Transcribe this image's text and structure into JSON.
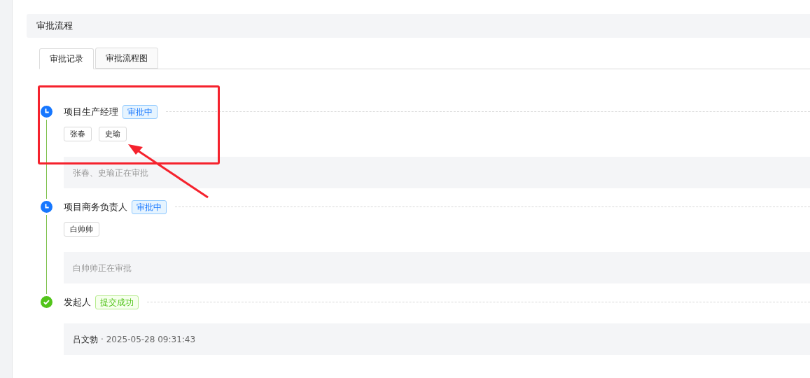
{
  "section": {
    "title": "审批流程"
  },
  "tabs": [
    {
      "label": "审批记录",
      "selected": true
    },
    {
      "label": "审批流程图",
      "selected": false
    }
  ],
  "steps": [
    {
      "kind": "pending",
      "title": "项目生产经理",
      "status": "审批中",
      "approvers": [
        "张春",
        "史瑜"
      ],
      "note": {
        "text": "张春、史瑜正在审批"
      }
    },
    {
      "kind": "pending",
      "title": "项目商务负责人",
      "status": "审批中",
      "approvers": [
        "白帅帅"
      ],
      "note": {
        "text": "白帅帅正在审批"
      }
    },
    {
      "kind": "done",
      "title": "发起人",
      "status": "提交成功",
      "note": {
        "name": "吕文勃",
        "time": "· 2025-05-28 09:31:43"
      }
    }
  ]
}
